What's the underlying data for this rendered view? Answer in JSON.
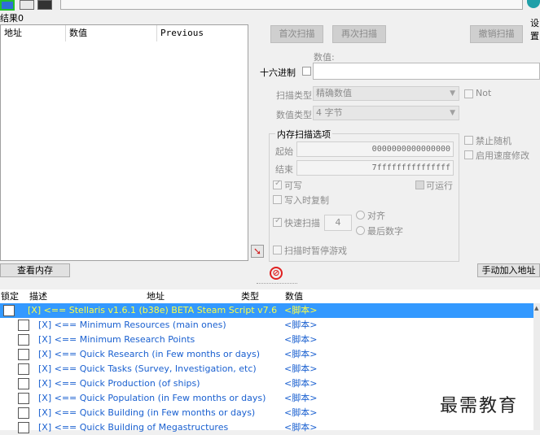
{
  "toolbar": {
    "settings_label": "设置"
  },
  "results": {
    "found_label": "结果0",
    "columns": [
      "地址",
      "数值",
      "Previous"
    ]
  },
  "scan": {
    "first_scan": "首次扫描",
    "next_scan": "再次扫描",
    "undo_scan": "撤销扫描",
    "value_label": "数值:",
    "hex_label": "十六进制",
    "scan_type_label": "扫描类型",
    "scan_type_value": "精确数值",
    "value_type_label": "数值类型",
    "value_type_value": "4 字节",
    "not_label": "Not",
    "mem_options_label": "内存扫描选项",
    "start_label": "起始",
    "start_value": "0000000000000000",
    "end_label": "结束",
    "end_value": "7fffffffffffffff",
    "writable_label": "可写",
    "executable_label": "可运行",
    "copy_on_write_label": "写入时复制",
    "fast_scan_label": "快速扫描",
    "fast_scan_value": "4",
    "align_label": "对齐",
    "last_digit_label": "最后数字",
    "pause_game_label": "扫描时暂停游戏",
    "disable_random_label": "禁止随机",
    "speedhack_label": "启用速度修改"
  },
  "buttons": {
    "view_memory": "查看内存",
    "add_address": "手动加入地址"
  },
  "table": {
    "headers": [
      "锁定",
      "描述",
      "地址",
      "类型",
      "数值"
    ],
    "rows": [
      {
        "desc": "[X] <== Stellaris v1.6.1 (b38e) BETA Steam Script v7.6",
        "value": "<脚本>"
      },
      {
        "desc": "[X] <== Minimum Resources (main ones)",
        "value": "<脚本>"
      },
      {
        "desc": "[X] <== Minimum Research Points",
        "value": "<脚本>"
      },
      {
        "desc": "[X] <== Quick Research (in Few months or days)",
        "value": "<脚本>"
      },
      {
        "desc": "[X] <== Quick Tasks  (Survey, Investigation, etc)",
        "value": "<脚本>"
      },
      {
        "desc": "[X] <== Quick Production (of ships)",
        "value": "<脚本>"
      },
      {
        "desc": "[X] <== Quick Population (in Few months or days)",
        "value": "<脚本>"
      },
      {
        "desc": "[X] <== Quick Building (in Few months or days)",
        "value": "<脚本>"
      },
      {
        "desc": "[X] <== Quick Building of Megastructures",
        "value": "<脚本>"
      }
    ]
  },
  "watermark": "最需教育",
  "colors": {
    "selection": "#3399ff",
    "script_text": "#1a60d0",
    "selected_text": "#ffff44"
  }
}
